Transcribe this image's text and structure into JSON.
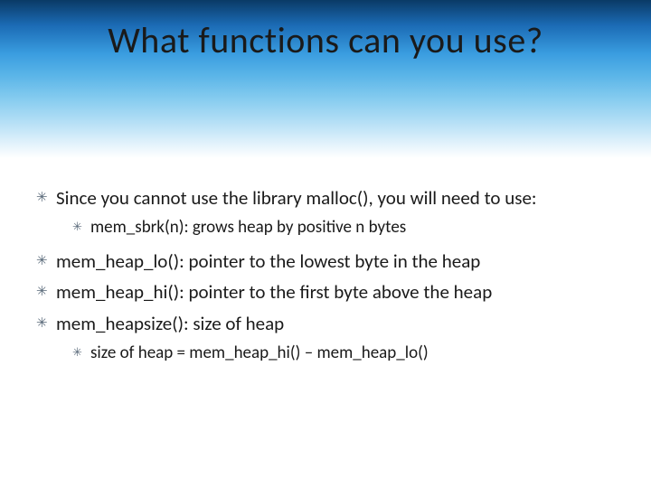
{
  "slide": {
    "title": "What functions can you use?",
    "bullets": {
      "b1": "Since you cannot use the library malloc(), you will need to use:",
      "b1_1": "mem_sbrk(n): grows heap by positive n bytes",
      "b2": "mem_heap_lo(): pointer to the lowest byte in the heap",
      "b3": "mem_heap_hi(): pointer to the first byte above the heap",
      "b4": "mem_heapsize(): size of heap",
      "b4_1": "size of heap = mem_heap_hi() – mem_heap_lo()"
    }
  }
}
